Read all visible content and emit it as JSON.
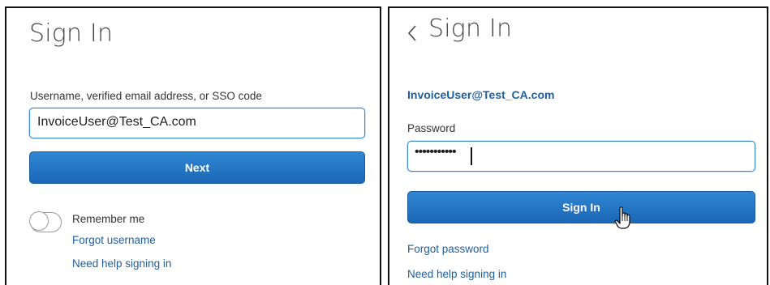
{
  "left": {
    "title": "Sign In",
    "username_label": "Username, verified email address, or SSO code",
    "username_value": "InvoiceUser@Test_CA.com",
    "next_button": "Next",
    "remember_me": "Remember me",
    "remember_me_on": false,
    "forgot_username": "Forgot username",
    "need_help": "Need help signing in"
  },
  "right": {
    "title": "Sign In",
    "back_icon": "chevron-left-icon",
    "user_email": "InvoiceUser@Test_CA.com",
    "password_label": "Password",
    "password_masked": "•••••••••••",
    "sign_in_button": "Sign In",
    "cursor_icon": "hand-pointer-icon",
    "forgot_password": "Forgot password",
    "need_help": "Need help signing in"
  },
  "colors": {
    "accent": "#1f6cba",
    "link": "#1f5fa0",
    "focus_border": "#3b8bd9",
    "title_text": "#4a4a4a"
  }
}
